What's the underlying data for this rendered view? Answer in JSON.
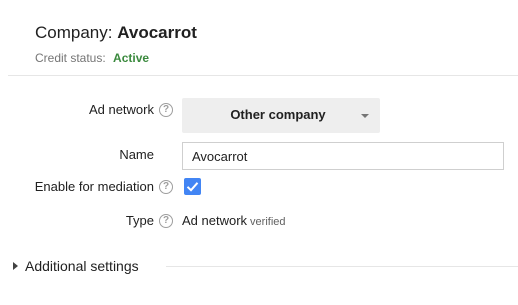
{
  "header": {
    "company_label": "Company:",
    "company_name": "Avocarrot",
    "credit_label": "Credit status:",
    "credit_value": "Active",
    "credit_color": "#3b8a3e"
  },
  "form": {
    "ad_network": {
      "label": "Ad network",
      "help_icon": "help-circle-icon",
      "selected": "Other company"
    },
    "name": {
      "label": "Name",
      "value": "Avocarrot"
    },
    "mediation": {
      "label": "Enable for mediation",
      "help_icon": "help-circle-icon",
      "checked": true,
      "checkbox_color": "#4285f4"
    },
    "type": {
      "label": "Type",
      "help_icon": "help-circle-icon",
      "value": "Ad network",
      "suffix": "verified"
    }
  },
  "additional_settings": {
    "label": "Additional settings",
    "expanded": false
  },
  "help_glyph": "?"
}
